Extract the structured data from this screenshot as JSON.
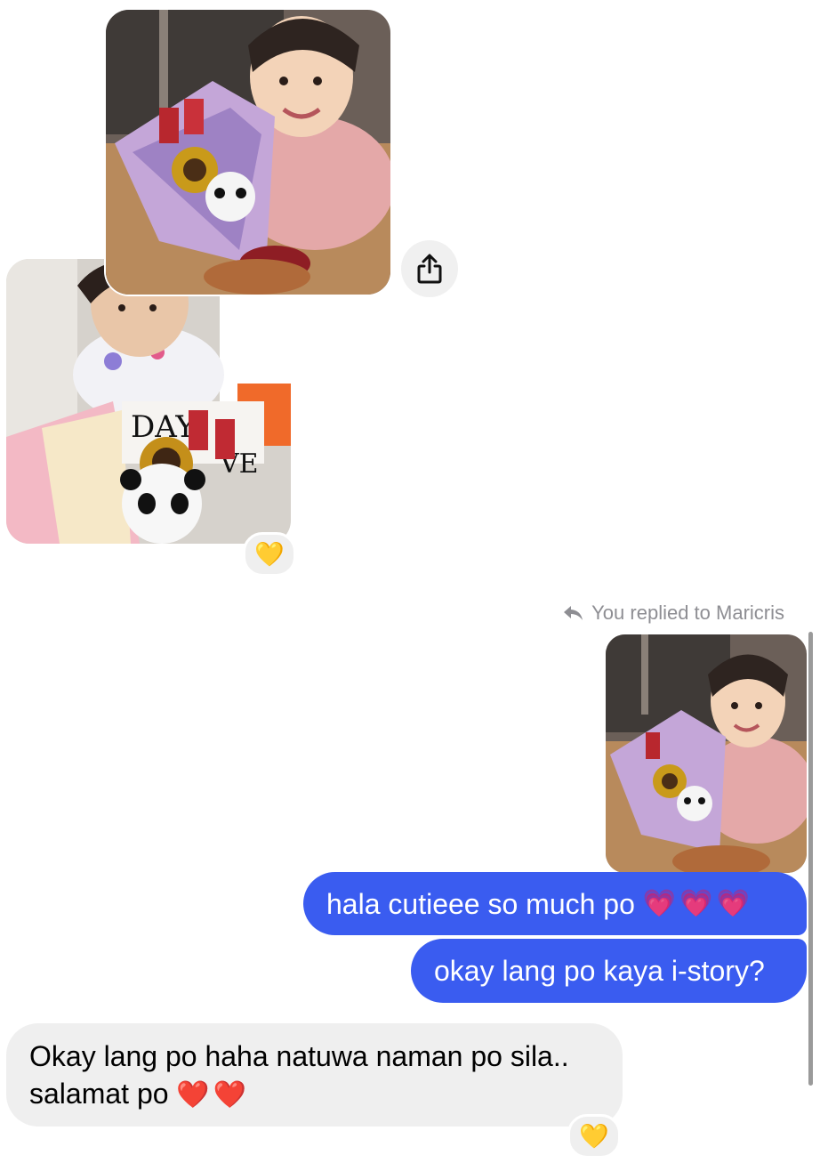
{
  "thread": {
    "photos": [
      {
        "subject": "girl-with-bouquet"
      },
      {
        "subject": "toddler-with-bouquet"
      },
      {
        "subject": "girl-with-bouquet"
      }
    ],
    "reaction_emoji": "💛",
    "reply_note": "You replied to Maricris",
    "messages": [
      {
        "text": "hala cutieee so much po",
        "emoji": "💗💗💗",
        "direction": "outgoing"
      },
      {
        "text": "okay lang po kaya i-story?",
        "direction": "outgoing"
      },
      {
        "line1": "Okay lang po haha natuwa naman po sila..",
        "line2": "salamat po",
        "emoji": "❤️❤️",
        "direction": "incoming",
        "reaction": "💛"
      }
    ]
  },
  "colors": {
    "outgoing_bubble": "#3a5cf0",
    "incoming_bubble": "#efefef",
    "meta_text": "#8e8e93"
  }
}
